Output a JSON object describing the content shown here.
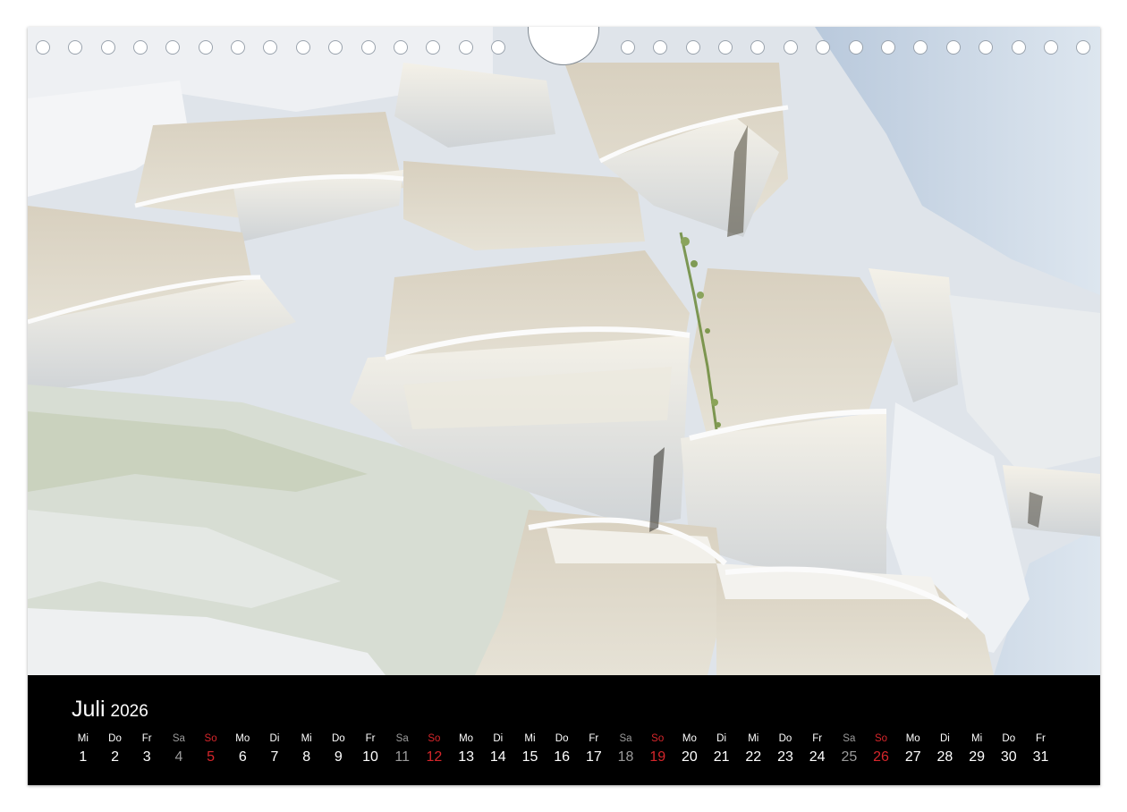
{
  "calendar": {
    "month": "Juli",
    "year": "2026",
    "days": [
      {
        "dow": "Mi",
        "num": "1",
        "kind": "weekday"
      },
      {
        "dow": "Do",
        "num": "2",
        "kind": "weekday"
      },
      {
        "dow": "Fr",
        "num": "3",
        "kind": "weekday"
      },
      {
        "dow": "Sa",
        "num": "4",
        "kind": "sat"
      },
      {
        "dow": "So",
        "num": "5",
        "kind": "sun"
      },
      {
        "dow": "Mo",
        "num": "6",
        "kind": "weekday"
      },
      {
        "dow": "Di",
        "num": "7",
        "kind": "weekday"
      },
      {
        "dow": "Mi",
        "num": "8",
        "kind": "weekday"
      },
      {
        "dow": "Do",
        "num": "9",
        "kind": "weekday"
      },
      {
        "dow": "Fr",
        "num": "10",
        "kind": "weekday"
      },
      {
        "dow": "Sa",
        "num": "11",
        "kind": "sat"
      },
      {
        "dow": "So",
        "num": "12",
        "kind": "sun"
      },
      {
        "dow": "Mo",
        "num": "13",
        "kind": "weekday"
      },
      {
        "dow": "Di",
        "num": "14",
        "kind": "weekday"
      },
      {
        "dow": "Mi",
        "num": "15",
        "kind": "weekday"
      },
      {
        "dow": "Do",
        "num": "16",
        "kind": "weekday"
      },
      {
        "dow": "Fr",
        "num": "17",
        "kind": "weekday"
      },
      {
        "dow": "Sa",
        "num": "18",
        "kind": "sat"
      },
      {
        "dow": "So",
        "num": "19",
        "kind": "sun"
      },
      {
        "dow": "Mo",
        "num": "20",
        "kind": "weekday"
      },
      {
        "dow": "Di",
        "num": "21",
        "kind": "weekday"
      },
      {
        "dow": "Mi",
        "num": "22",
        "kind": "weekday"
      },
      {
        "dow": "Do",
        "num": "23",
        "kind": "weekday"
      },
      {
        "dow": "Fr",
        "num": "24",
        "kind": "weekday"
      },
      {
        "dow": "Sa",
        "num": "25",
        "kind": "sat"
      },
      {
        "dow": "So",
        "num": "26",
        "kind": "sun"
      },
      {
        "dow": "Mo",
        "num": "27",
        "kind": "weekday"
      },
      {
        "dow": "Di",
        "num": "28",
        "kind": "weekday"
      },
      {
        "dow": "Mi",
        "num": "29",
        "kind": "weekday"
      },
      {
        "dow": "Do",
        "num": "30",
        "kind": "weekday"
      },
      {
        "dow": "Fr",
        "num": "31",
        "kind": "weekday"
      }
    ]
  },
  "colors": {
    "sunday": "#d6262b",
    "saturday": "#9b9b9b",
    "background": "#000000",
    "text": "#ffffff"
  }
}
